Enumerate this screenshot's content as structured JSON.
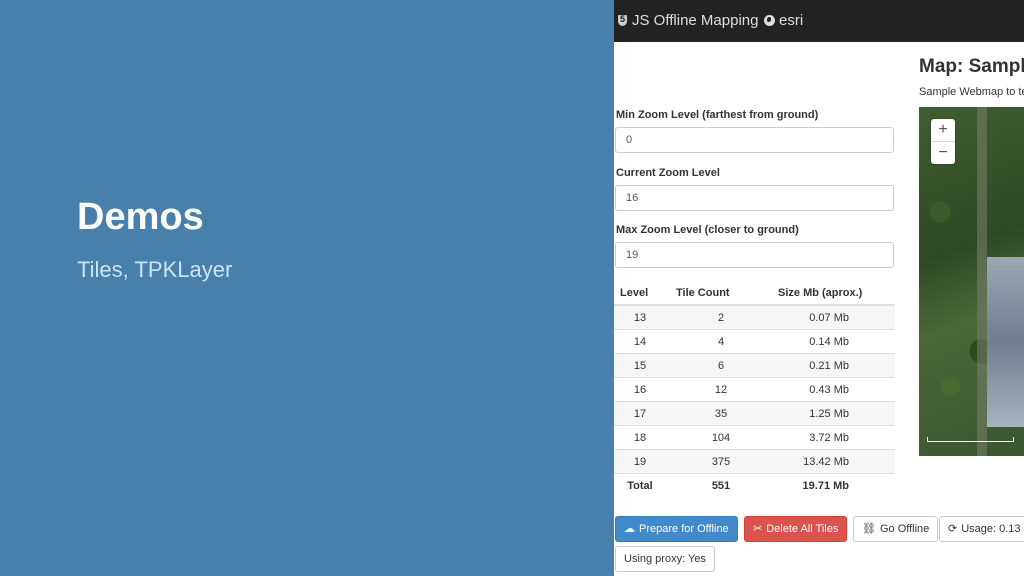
{
  "slide": {
    "title": "Demos",
    "subtitle": "Tiles, TPKLayer"
  },
  "navbar": {
    "brand": "JS Offline Mapping",
    "link": "esri"
  },
  "form": {
    "min_zoom": {
      "label": "Min Zoom Level (farthest from ground)",
      "value": "0"
    },
    "current_zoom": {
      "label": "Current Zoom Level",
      "value": "16"
    },
    "max_zoom": {
      "label": "Max Zoom Level (closer to ground)",
      "value": "19"
    }
  },
  "table": {
    "headers": [
      "Level",
      "Tile Count",
      "Size Mb (aprox.)"
    ],
    "rows": [
      [
        "13",
        "2",
        "0.07 Mb"
      ],
      [
        "14",
        "4",
        "0.14 Mb"
      ],
      [
        "15",
        "6",
        "0.21 Mb"
      ],
      [
        "16",
        "12",
        "0.43 Mb"
      ],
      [
        "17",
        "35",
        "1.25 Mb"
      ],
      [
        "18",
        "104",
        "3.72 Mb"
      ],
      [
        "19",
        "375",
        "13.42 Mb"
      ]
    ],
    "total": [
      "Total",
      "551",
      "19.71 Mb"
    ]
  },
  "map": {
    "title": "Map: Sample",
    "subtitle": "Sample Webmap to te",
    "zoom_in": "+",
    "zoom_out": "−"
  },
  "buttons": {
    "prepare": "Prepare for Offline",
    "delete": "Delete All Tiles",
    "go_offline": "Go Offline",
    "usage": "Usage: 0.13",
    "proxy": "Using proxy: Yes"
  },
  "colors": {
    "slide_bg": "#4680ab",
    "navbar_bg": "#222222",
    "primary": "#428bca",
    "danger": "#d9534f"
  }
}
